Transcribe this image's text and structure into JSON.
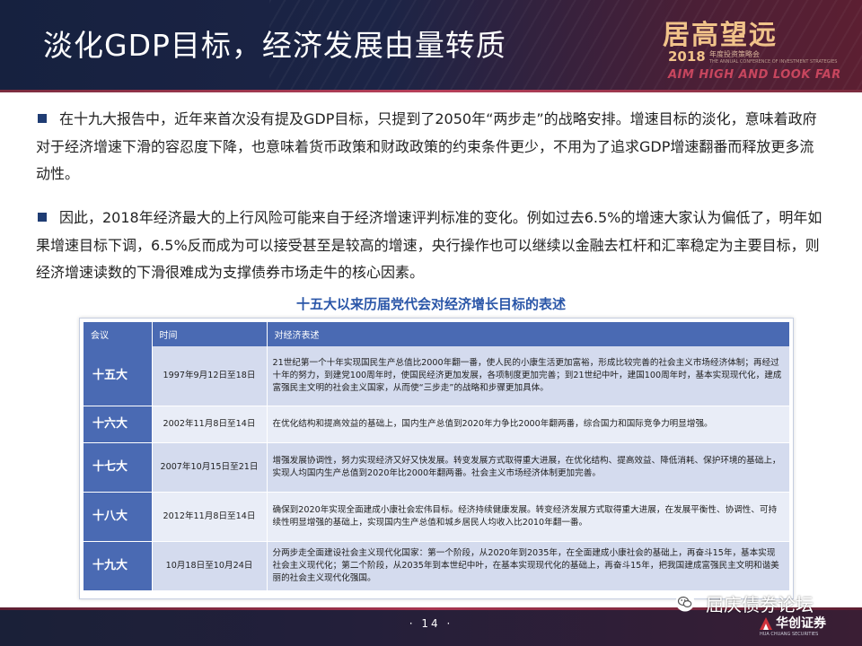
{
  "header": {
    "title": "淡化GDP目标，经济发展由量转质",
    "brand_cn": "居高望远",
    "brand_year": "2018",
    "brand_sub_cn": "年度投资策略会",
    "brand_sub_en": "THE ANNUAL CONFERENCE OF INVESTMENT STRATEGIES",
    "brand_en": "AIM HIGH AND LOOK FAR"
  },
  "paragraphs": [
    "在十九大报告中，近年来首次没有提及GDP目标，只提到了2050年“两步走”的战略安排。增速目标的淡化，意味着政府对于经济增速下滑的容忍度下降，也意味着货币政策和财政政策的约束条件更少，不用为了追求GDP增速翻番而释放更多流动性。",
    "因此，2018年经济最大的上行风险可能来自于经济增速评判标准的变化。例如过去6.5%的增速大家认为偏低了，明年如果增速目标下调，6.5%反而成为可以接受甚至是较高的增速，央行操作也可以继续以金融去杠杆和汇率稳定为主要目标，则经济增速读数的下滑很难成为支撑债券市场走牛的核心因素。"
  ],
  "table": {
    "title": "十五大以来历届党代会对经济增长目标的表述",
    "headers": [
      "会议",
      "时间",
      "对经济表述"
    ],
    "rows": [
      {
        "congress": "十五大",
        "date": "1997年9月12日至18日",
        "text": "21世纪第一个十年实现国民生产总值比2000年翻一番，使人民的小康生活更加富裕，形成比较完善的社会主义市场经济体制；再经过十年的努力，到建党100周年时，使国民经济更加发展，各项制度更加完善；到21世纪中叶，建国100周年时，基本实现现代化，建成富强民主文明的社会主义国家，从而使“三步走”的战略和步骤更加具体。"
      },
      {
        "congress": "十六大",
        "date": "2002年11月8日至14日",
        "text": "在优化结构和提高效益的基础上，国内生产总值到2020年力争比2000年翻两番，综合国力和国际竞争力明显增强。"
      },
      {
        "congress": "十七大",
        "date": "2007年10月15日至21日",
        "text": "增强发展协调性，努力实现经济又好又快发展。转变发展方式取得重大进展，在优化结构、提高效益、降低消耗、保护环境的基础上，实现人均国内生产总值到2020年比2000年翻两番。社会主义市场经济体制更加完善。"
      },
      {
        "congress": "十八大",
        "date": "2012年11月8日至14日",
        "text": "确保到2020年实现全面建成小康社会宏伟目标。经济持续健康发展。转变经济发展方式取得重大进展，在发展平衡性、协调性、可持续性明显增强的基础上，实现国内生产总值和城乡居民人均收入比2010年翻一番。"
      },
      {
        "congress": "十九大",
        "date": "10月18日至10月24日",
        "text": "分两步走全面建设社会主义现代化国家：第一个阶段，从2020年到2035年，在全面建成小康社会的基础上，再奋斗15年，基本实现社会主义现代化；第二个阶段，从2035年到本世纪中叶，在基本实现现代化的基础上，再奋斗15年，把我国建成富强民主文明和谐美丽的社会主义现代化强国。"
      }
    ]
  },
  "footer": {
    "page_number": "· 14 ·",
    "watermark": "屈庆债券论坛",
    "logo_cn": "华创证券",
    "logo_en": "HUA CHUANG SECURITIES"
  }
}
